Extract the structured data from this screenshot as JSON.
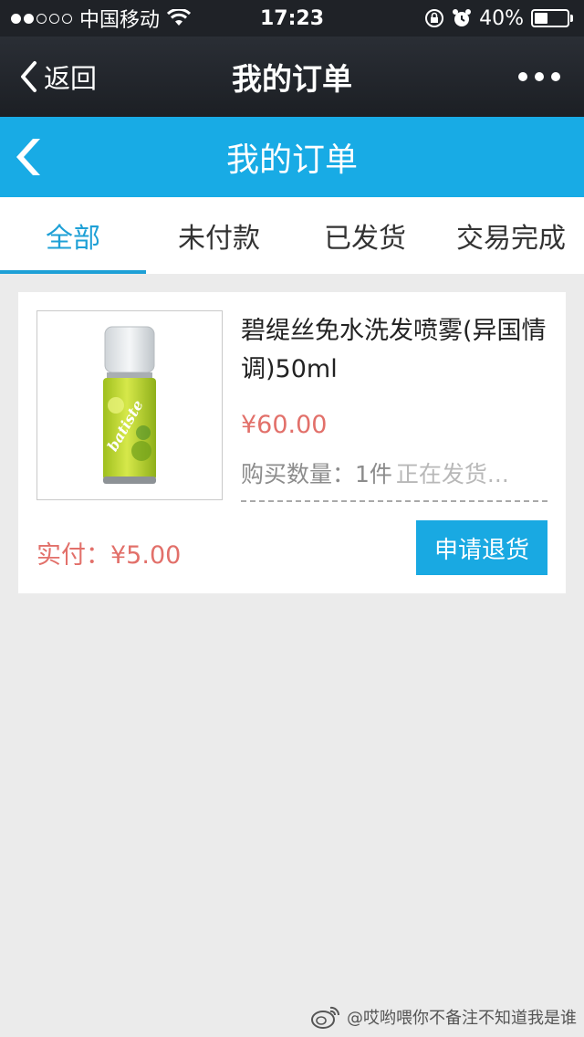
{
  "status_bar": {
    "carrier": "中国移动",
    "time": "17:23",
    "battery": "40%",
    "battery_level": 0.4
  },
  "nav": {
    "back_label": "返回",
    "title": "我的订单"
  },
  "page_header": {
    "title": "我的订单"
  },
  "tabs": [
    {
      "label": "全部",
      "active": true
    },
    {
      "label": "未付款",
      "active": false
    },
    {
      "label": "已发货",
      "active": false
    },
    {
      "label": "交易完成",
      "active": false
    }
  ],
  "order": {
    "product_name": "碧缇丝免水洗发喷雾(异国情调)50ml",
    "price": "¥60.00",
    "quantity_label": "购买数量：",
    "quantity_value": "1件",
    "ship_status": "正在发货...",
    "paid_label": "实付：¥5.00",
    "refund_button": "申请退货",
    "brand_on_can": "batiste"
  },
  "watermark": {
    "text": "@哎哟喂你不备注不知道我是谁"
  },
  "colors": {
    "accent": "#18abe5",
    "price": "#e2706a",
    "nav": "#1f2227"
  }
}
